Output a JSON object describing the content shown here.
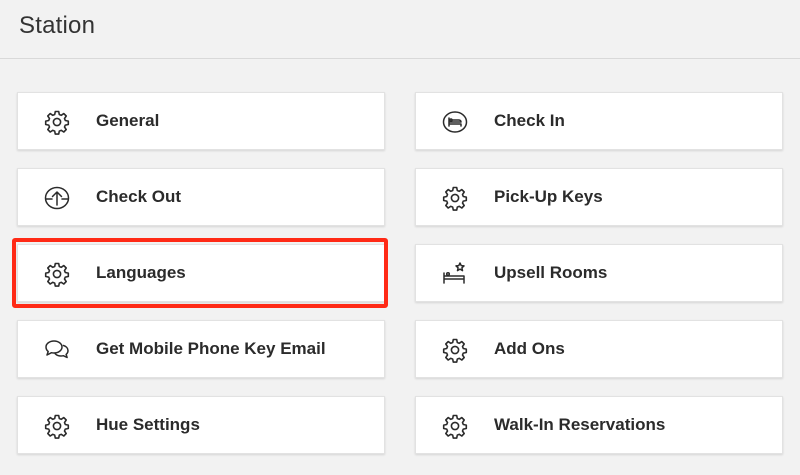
{
  "page": {
    "title": "Station"
  },
  "tiles": {
    "general": {
      "label": "General",
      "icon": "gear-icon"
    },
    "check_in": {
      "label": "Check In",
      "icon": "bed-icon"
    },
    "check_out": {
      "label": "Check Out",
      "icon": "upload-arrow-icon"
    },
    "pick_up_keys": {
      "label": "Pick-Up Keys",
      "icon": "gear-icon"
    },
    "languages": {
      "label": "Languages",
      "icon": "gear-icon"
    },
    "upsell_rooms": {
      "label": "Upsell Rooms",
      "icon": "bed-star-icon"
    },
    "mobile_key_email": {
      "label": "Get Mobile Phone Key Email",
      "icon": "chat-bubbles-icon"
    },
    "add_ons": {
      "label": "Add Ons",
      "icon": "gear-icon"
    },
    "hue_settings": {
      "label": "Hue Settings",
      "icon": "gear-icon"
    },
    "walk_in_reservations": {
      "label": "Walk-In Reservations",
      "icon": "gear-icon"
    }
  },
  "colors": {
    "highlight": "#ff2a16",
    "background": "#f2f2f2",
    "tile": "#ffffff"
  }
}
